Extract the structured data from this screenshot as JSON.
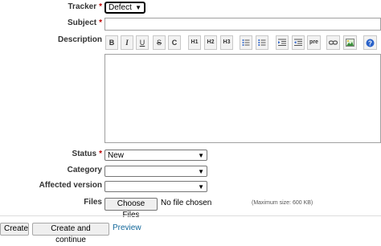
{
  "form": {
    "tracker": {
      "label": "Tracker",
      "value": "Defect"
    },
    "subject": {
      "label": "Subject",
      "value": ""
    },
    "description": {
      "label": "Description"
    },
    "status": {
      "label": "Status",
      "value": "New"
    },
    "category": {
      "label": "Category",
      "value": ""
    },
    "affected_version": {
      "label": "Affected version",
      "value": ""
    },
    "files": {
      "label": "Files",
      "button_label": "Choose Files",
      "status_text": "No file chosen",
      "hint": "(Maximum size: 600 KB)"
    },
    "required_marker": "*"
  },
  "toolbar": [
    {
      "name": "bold",
      "glyph": "B"
    },
    {
      "name": "italic",
      "glyph": "I"
    },
    {
      "name": "underline",
      "glyph": "U"
    },
    {
      "name": "strikethrough",
      "glyph": "S"
    },
    {
      "name": "code",
      "glyph": "C"
    },
    {
      "name": "heading-1",
      "glyph": "H1"
    },
    {
      "name": "heading-2",
      "glyph": "H2"
    },
    {
      "name": "heading-3",
      "glyph": "H3"
    },
    {
      "name": "unordered-list",
      "icon": "bullet-list-icon"
    },
    {
      "name": "ordered-list",
      "icon": "numbered-list-icon"
    },
    {
      "name": "indent",
      "icon": "indent-icon"
    },
    {
      "name": "outdent",
      "icon": "outdent-icon"
    },
    {
      "name": "preformatted",
      "glyph": "pre"
    },
    {
      "name": "link",
      "icon": "link-icon"
    },
    {
      "name": "image",
      "icon": "image-icon"
    },
    {
      "name": "help",
      "icon": "help-icon"
    }
  ],
  "actions": {
    "create_label": "Create",
    "create_continue_label": "Create and continue",
    "preview_label": "Preview"
  },
  "colors": {
    "required": "#bb0000",
    "link": "#116699",
    "image_icon_green": "#3a8f3a",
    "help_icon_blue": "#2a62c9"
  }
}
